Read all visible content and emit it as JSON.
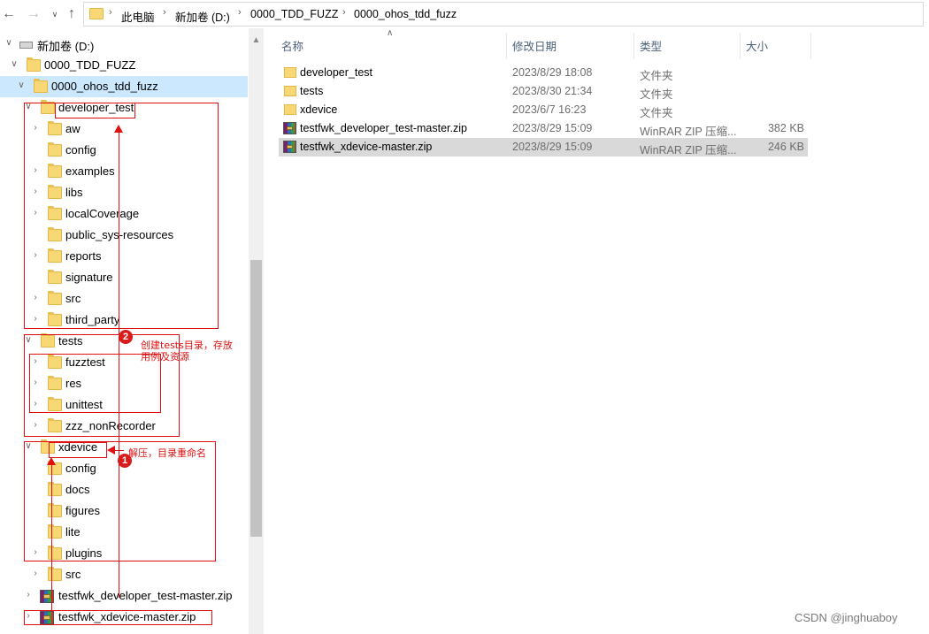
{
  "address_bar": {
    "breadcrumbs": [
      "此电脑",
      "新加卷 (D:)",
      "0000_TDD_FUZZ",
      "0000_ohos_tdd_fuzz"
    ]
  },
  "tree": {
    "drive": "新加卷 (D:)",
    "root": "0000_TDD_FUZZ",
    "current": "0000_ohos_tdd_fuzz",
    "developer_test": {
      "label": "developer_test",
      "children": [
        "aw",
        "config",
        "examples",
        "libs",
        "localCoverage",
        "public_sys-resources",
        "reports",
        "signature",
        "src",
        "third_party"
      ]
    },
    "tests": {
      "label": "tests",
      "children": [
        "fuzztest",
        "res",
        "unittest",
        "zzz_nonRecorder"
      ]
    },
    "xdevice": {
      "label": "xdevice",
      "children": [
        "config",
        "docs",
        "figures",
        "lite",
        "plugins",
        "src"
      ]
    },
    "zips": [
      "testfwk_developer_test-master.zip",
      "testfwk_xdevice-master.zip"
    ]
  },
  "columns": {
    "name": "名称",
    "date": "修改日期",
    "type": "类型",
    "size": "大小"
  },
  "files": [
    {
      "name": "developer_test",
      "date": "2023/8/29 18:08",
      "type": "文件夹",
      "size": "",
      "icon": "folder-icon"
    },
    {
      "name": "tests",
      "date": "2023/8/30 21:34",
      "type": "文件夹",
      "size": "",
      "icon": "folder-icon"
    },
    {
      "name": "xdevice",
      "date": "2023/6/7 16:23",
      "type": "文件夹",
      "size": "",
      "icon": "folder-icon"
    },
    {
      "name": "testfwk_developer_test-master.zip",
      "date": "2023/8/29 15:09",
      "type": "WinRAR ZIP 压缩...",
      "size": "382 KB",
      "icon": "winrar-zip-icon"
    },
    {
      "name": "testfwk_xdevice-master.zip",
      "date": "2023/8/29 15:09",
      "type": "WinRAR ZIP 压缩...",
      "size": "246 KB",
      "icon": "winrar-zip-icon",
      "selected": true
    }
  ],
  "annotations": {
    "step1_badge": "1",
    "step1_text": "解压，目录重命名",
    "step2_badge": "2",
    "step2_text_line1": "创建tests目录，存放",
    "step2_text_line2": "用例及资源"
  },
  "watermark": "CSDN @jinghuaboy",
  "colors": {
    "selection": "#cce8ff",
    "annotation_red": "#e01010",
    "folder": "#f8d775"
  }
}
